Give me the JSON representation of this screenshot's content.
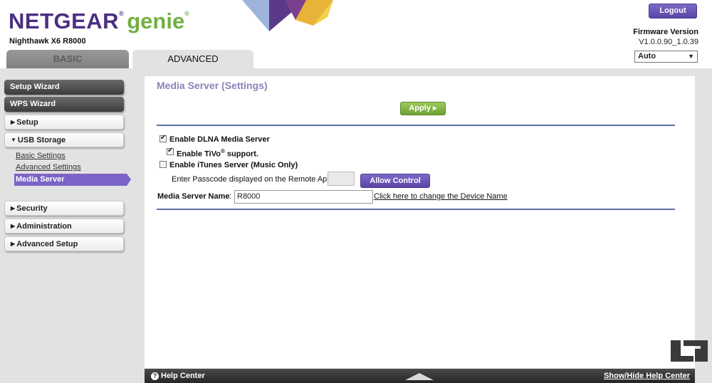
{
  "header": {
    "brand": "NETGEAR",
    "brand_sub": "genie",
    "reg_mark": "®",
    "model": "Nighthawk X6 R8000",
    "logout_label": "Logout",
    "firmware_label": "Firmware Version",
    "firmware_value": "V1.0.0.90_1.0.39",
    "language": "Auto",
    "tabs": [
      {
        "label": "BASIC"
      },
      {
        "label": "ADVANCED"
      }
    ]
  },
  "sidebar": {
    "setup_wizard": "Setup Wizard",
    "wps_wizard": "WPS Wizard",
    "setup": "Setup",
    "usb_storage": "USB Storage",
    "sub_items": [
      {
        "label": "Basic Settings"
      },
      {
        "label": "Advanced Settings"
      },
      {
        "label": "Media Server"
      }
    ],
    "security": "Security",
    "administration": "Administration",
    "advanced_setup": "Advanced Setup"
  },
  "main": {
    "title": "Media Server (Settings)",
    "apply_label": "Apply ▸",
    "dlna_label": "Enable DLNA Media Server",
    "dlna_checked": true,
    "tivo_label": "Enable TiVo",
    "tivo_reg": "®",
    "tivo_suffix": " support.",
    "tivo_checked": true,
    "itunes_label": "Enable iTunes Server (Music Only)",
    "itunes_checked": false,
    "passcode_label": "Enter Passcode displayed on the Remote App",
    "allow_label": "Allow Control",
    "server_name_label": "Media Server Name",
    "colon": ":",
    "server_name_value": "R8000",
    "change_name_link": "Click here to change the Device Name"
  },
  "footer": {
    "help_center": "Help Center",
    "show_hide": "Show/Hide Help Center"
  },
  "colors": {
    "brand_purple": "#4b2e83",
    "genie_green": "#72b043",
    "accent_purple": "#7b63c8",
    "apply_green": "#7fb043",
    "rule_blue": "#5b6fa6"
  }
}
